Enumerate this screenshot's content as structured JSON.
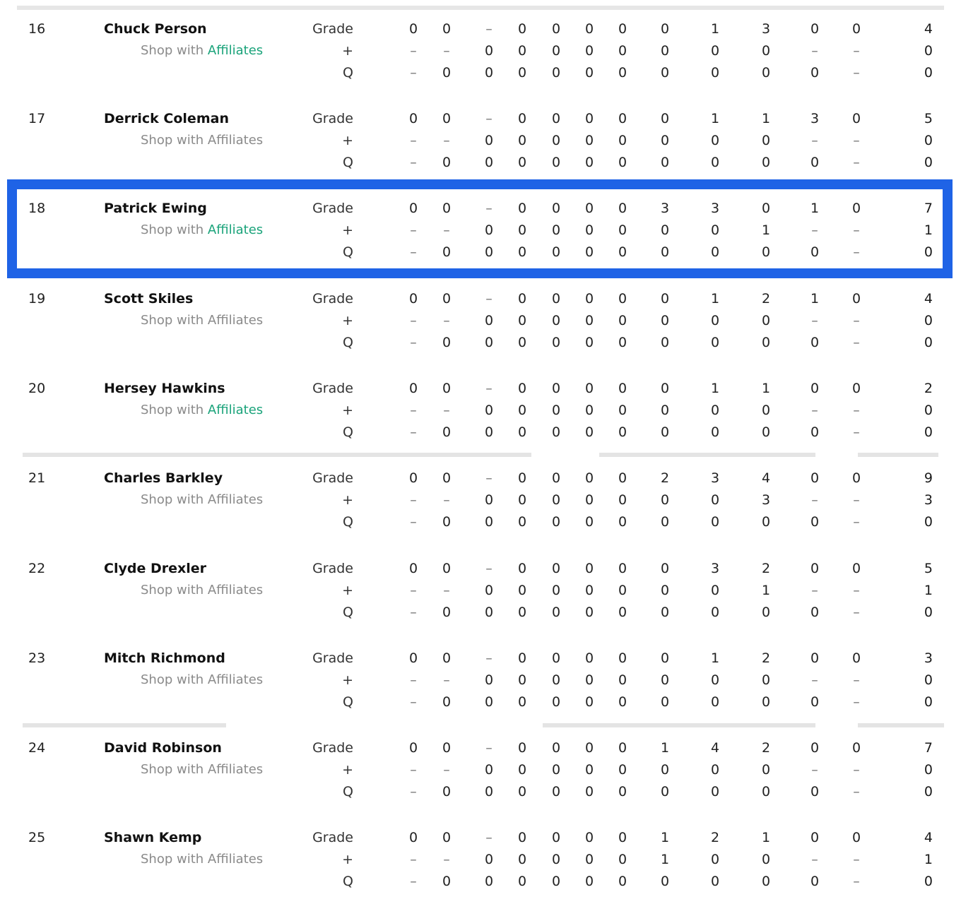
{
  "columns_count": 13,
  "row_labels": [
    "Grade",
    "+",
    "Q"
  ],
  "shop_text": "Shop with ",
  "affiliates_text": "Affiliates",
  "players": [
    {
      "rank": "16",
      "name": "Chuck Person",
      "highlighted": false,
      "aff_green": true,
      "rows": [
        [
          "0",
          "0",
          "–",
          "0",
          "0",
          "0",
          "0",
          "0",
          "1",
          "3",
          "0",
          "0",
          "4"
        ],
        [
          "–",
          "–",
          "0",
          "0",
          "0",
          "0",
          "0",
          "0",
          "0",
          "0",
          "–",
          "–",
          "0"
        ],
        [
          "–",
          "0",
          "0",
          "0",
          "0",
          "0",
          "0",
          "0",
          "0",
          "0",
          "0",
          "–",
          "0"
        ]
      ]
    },
    {
      "rank": "17",
      "name": "Derrick Coleman",
      "highlighted": false,
      "aff_green": false,
      "rows": [
        [
          "0",
          "0",
          "–",
          "0",
          "0",
          "0",
          "0",
          "0",
          "1",
          "1",
          "3",
          "0",
          "5"
        ],
        [
          "–",
          "–",
          "0",
          "0",
          "0",
          "0",
          "0",
          "0",
          "0",
          "0",
          "–",
          "–",
          "0"
        ],
        [
          "–",
          "0",
          "0",
          "0",
          "0",
          "0",
          "0",
          "0",
          "0",
          "0",
          "0",
          "–",
          "0"
        ]
      ]
    },
    {
      "rank": "18",
      "name": "Patrick Ewing",
      "highlighted": true,
      "aff_green": true,
      "rows": [
        [
          "0",
          "0",
          "–",
          "0",
          "0",
          "0",
          "0",
          "3",
          "3",
          "0",
          "1",
          "0",
          "7"
        ],
        [
          "–",
          "–",
          "0",
          "0",
          "0",
          "0",
          "0",
          "0",
          "0",
          "1",
          "–",
          "–",
          "1"
        ],
        [
          "–",
          "0",
          "0",
          "0",
          "0",
          "0",
          "0",
          "0",
          "0",
          "0",
          "0",
          "–",
          "0"
        ]
      ]
    },
    {
      "rank": "19",
      "name": "Scott Skiles",
      "highlighted": false,
      "aff_green": false,
      "rows": [
        [
          "0",
          "0",
          "–",
          "0",
          "0",
          "0",
          "0",
          "0",
          "1",
          "2",
          "1",
          "0",
          "4"
        ],
        [
          "–",
          "–",
          "0",
          "0",
          "0",
          "0",
          "0",
          "0",
          "0",
          "0",
          "–",
          "–",
          "0"
        ],
        [
          "–",
          "0",
          "0",
          "0",
          "0",
          "0",
          "0",
          "0",
          "0",
          "0",
          "0",
          "–",
          "0"
        ]
      ]
    },
    {
      "rank": "20",
      "name": "Hersey Hawkins",
      "highlighted": false,
      "aff_green": true,
      "rows": [
        [
          "0",
          "0",
          "–",
          "0",
          "0",
          "0",
          "0",
          "0",
          "1",
          "1",
          "0",
          "0",
          "2"
        ],
        [
          "–",
          "–",
          "0",
          "0",
          "0",
          "0",
          "0",
          "0",
          "0",
          "0",
          "–",
          "–",
          "0"
        ],
        [
          "–",
          "0",
          "0",
          "0",
          "0",
          "0",
          "0",
          "0",
          "0",
          "0",
          "0",
          "–",
          "0"
        ]
      ]
    },
    {
      "rank": "21",
      "name": "Charles Barkley",
      "highlighted": false,
      "aff_green": false,
      "rows": [
        [
          "0",
          "0",
          "–",
          "0",
          "0",
          "0",
          "0",
          "2",
          "3",
          "4",
          "0",
          "0",
          "9"
        ],
        [
          "–",
          "–",
          "0",
          "0",
          "0",
          "0",
          "0",
          "0",
          "0",
          "3",
          "–",
          "–",
          "3"
        ],
        [
          "–",
          "0",
          "0",
          "0",
          "0",
          "0",
          "0",
          "0",
          "0",
          "0",
          "0",
          "–",
          "0"
        ]
      ]
    },
    {
      "rank": "22",
      "name": "Clyde Drexler",
      "highlighted": false,
      "aff_green": false,
      "rows": [
        [
          "0",
          "0",
          "–",
          "0",
          "0",
          "0",
          "0",
          "0",
          "3",
          "2",
          "0",
          "0",
          "5"
        ],
        [
          "–",
          "–",
          "0",
          "0",
          "0",
          "0",
          "0",
          "0",
          "0",
          "1",
          "–",
          "–",
          "1"
        ],
        [
          "–",
          "0",
          "0",
          "0",
          "0",
          "0",
          "0",
          "0",
          "0",
          "0",
          "0",
          "–",
          "0"
        ]
      ]
    },
    {
      "rank": "23",
      "name": "Mitch Richmond",
      "highlighted": false,
      "aff_green": false,
      "rows": [
        [
          "0",
          "0",
          "–",
          "0",
          "0",
          "0",
          "0",
          "0",
          "1",
          "2",
          "0",
          "0",
          "3"
        ],
        [
          "–",
          "–",
          "0",
          "0",
          "0",
          "0",
          "0",
          "0",
          "0",
          "0",
          "–",
          "–",
          "0"
        ],
        [
          "–",
          "0",
          "0",
          "0",
          "0",
          "0",
          "0",
          "0",
          "0",
          "0",
          "0",
          "–",
          "0"
        ]
      ]
    },
    {
      "rank": "24",
      "name": "David Robinson",
      "highlighted": false,
      "aff_green": false,
      "rows": [
        [
          "0",
          "0",
          "–",
          "0",
          "0",
          "0",
          "0",
          "1",
          "4",
          "2",
          "0",
          "0",
          "7"
        ],
        [
          "–",
          "–",
          "0",
          "0",
          "0",
          "0",
          "0",
          "0",
          "0",
          "0",
          "–",
          "–",
          "0"
        ],
        [
          "–",
          "0",
          "0",
          "0",
          "0",
          "0",
          "0",
          "0",
          "0",
          "0",
          "0",
          "–",
          "0"
        ]
      ]
    },
    {
      "rank": "25",
      "name": "Shawn Kemp",
      "highlighted": false,
      "aff_green": false,
      "rows": [
        [
          "0",
          "0",
          "–",
          "0",
          "0",
          "0",
          "0",
          "1",
          "2",
          "1",
          "0",
          "0",
          "4"
        ],
        [
          "–",
          "–",
          "0",
          "0",
          "0",
          "0",
          "0",
          "1",
          "0",
          "0",
          "–",
          "–",
          "1"
        ],
        [
          "–",
          "0",
          "0",
          "0",
          "0",
          "0",
          "0",
          "0",
          "0",
          "0",
          "0",
          "–",
          "0"
        ]
      ]
    }
  ],
  "colors": {
    "highlight_border": "#1f63e6",
    "affiliate_link": "#1aa37a",
    "muted_text": "#8a8a8a",
    "separator": "#e4e4e4"
  }
}
